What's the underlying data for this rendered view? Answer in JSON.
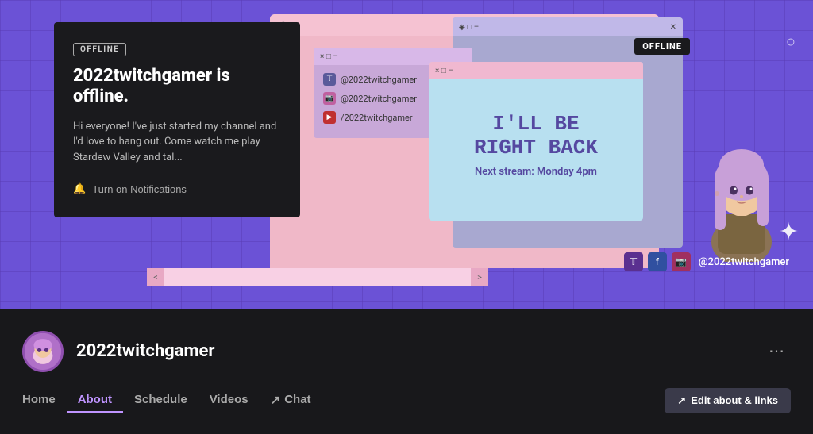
{
  "banner": {
    "offline_badge": "OFFLINE",
    "offline_title": "2022twitchgamer is offline.",
    "offline_desc": "Hi everyone! I've just started my channel and I'd love to hang out. Come watch me play Stardew Valley and tal...",
    "notif_label": "Turn on Notifications",
    "offline_topright": "OFFLINE",
    "social_handle": "@2022twitchgamer",
    "brb_line1": "I'LL BE",
    "brb_line2": "RIGHT BACK",
    "brb_sub": "Next stream: Monday 4pm",
    "links": [
      {
        "icon": "T",
        "label": "@2022twitchgamer"
      },
      {
        "icon": "I",
        "label": "@2022twitchgamer"
      },
      {
        "icon": "Y",
        "label": "/2022twitchgamer"
      }
    ]
  },
  "channel": {
    "name": "2022twitchgamer",
    "three_dots": "⋯"
  },
  "nav": {
    "tabs": [
      {
        "label": "Home",
        "active": false
      },
      {
        "label": "About",
        "active": true
      },
      {
        "label": "Schedule",
        "active": false
      },
      {
        "label": "Videos",
        "active": false
      },
      {
        "label": "Chat",
        "active": false,
        "icon": "↗"
      }
    ],
    "edit_btn": "Edit about & links",
    "edit_icon": "↗"
  }
}
